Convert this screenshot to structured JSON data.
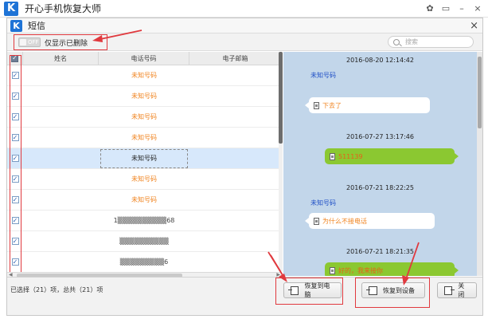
{
  "app": {
    "title": "开心手机恢复大师",
    "logo": "K"
  },
  "window_controls": [
    "wechat-icon",
    "chat-icon",
    "minimize-icon",
    "close-icon"
  ],
  "dialog": {
    "title": "短信",
    "logo": "K",
    "close": "×"
  },
  "filter": {
    "toggle_text": "OFF",
    "label": "仅显示已删除"
  },
  "search": {
    "placeholder": "搜索"
  },
  "table": {
    "headers": {
      "name": "姓名",
      "phone": "电话号码",
      "email": "电子邮箱"
    },
    "rows": [
      {
        "phone": "未知号码"
      },
      {
        "phone": "未知号码"
      },
      {
        "phone": "未知号码"
      },
      {
        "phone": "未知号码"
      },
      {
        "phone": "未知号码"
      },
      {
        "phone": "未知号码"
      },
      {
        "phone": "未知号码"
      },
      {
        "phone": "1▒▒▒▒▒▒▒▒▒▒68"
      },
      {
        "phone": "▒▒▒▒▒▒▒▒▒▒"
      },
      {
        "phone": "▒▒▒▒▒▒▒▒▒6"
      }
    ]
  },
  "chat": [
    {
      "time": "2016-08-20 12:14:42",
      "sender": "未知号码",
      "text": "下去了",
      "dir": "in"
    },
    {
      "time": "2016-07-27 13:17:46",
      "text": "511139",
      "dir": "out"
    },
    {
      "time": "2016-07-21 18:22:25",
      "sender": "未知号码",
      "text": "为什么不接电话",
      "dir": "in"
    },
    {
      "time": "2016-07-21 18:21:35",
      "text": "好的，我来接你",
      "dir": "out"
    }
  ],
  "footer": {
    "status": "已选择（21）项，总共（21）项",
    "restore_pc": "恢复到电脑",
    "restore_device": "恢复到设备",
    "close": "关闭"
  },
  "colors": {
    "accent": "#1e73d6",
    "highlight": "#e0393e",
    "unknown_number": "#f0831e",
    "chat_bg": "#c2d6ea",
    "out_bubble": "#8bc831"
  }
}
